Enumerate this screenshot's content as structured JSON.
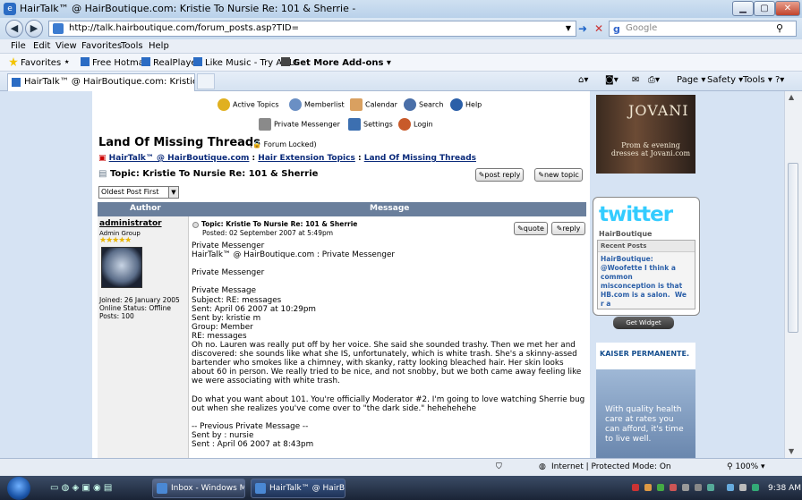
{
  "window": {
    "title": "HairTalk™ @ HairBoutique.com: Kristie To Nursie Re: 101 & Sherrie -"
  },
  "address": {
    "url": "http://talk.hairboutique.com/forum_posts.asp?TID=",
    "search_placeholder": "Google"
  },
  "menu": [
    "File",
    "Edit",
    "View",
    "Favorites",
    "Tools",
    "Help"
  ],
  "favorites_bar": {
    "favorites": "Favorites",
    "items": [
      "Free Hotmail",
      "RealPlayer",
      "Like Music - Try AOL!",
      "Get More Add-ons"
    ]
  },
  "tab": {
    "label": "HairTalk™ @ HairBoutique.com: Kristie To Nursie..."
  },
  "commands": [
    "Page",
    "Safety",
    "Tools"
  ],
  "forum_nav": [
    "Active Topics",
    "Memberlist",
    "Calendar",
    "Search",
    "Help",
    "Private Messenger",
    "Settings",
    "Login"
  ],
  "forum": {
    "title": "Land Of Missing Threads",
    "locked": "Forum Locked",
    "breadcrumb": [
      "HairTalk™ @ HairBoutique.com",
      "Hair Extension Topics",
      "Land Of Missing Threads"
    ],
    "topic": "Topic: Kristie To Nursie Re: 101 & Sherrie",
    "post_reply": "post reply",
    "new_topic": "new topic",
    "sort": "Oldest Post First",
    "col_author": "Author",
    "col_message": "Message"
  },
  "post": {
    "author": "administrator",
    "group": "Admin Group",
    "stars": "★★★★★",
    "joined": "Joined: 26 January 2005",
    "status": "Online Status: Offline",
    "posts": "Posts: 100",
    "title": "Topic: Kristie To Nursie Re: 101 & Sherrie",
    "posted": "Posted: 02 September 2007 at 5:49pm",
    "quote": "quote",
    "reply": "reply",
    "body": "Private Messenger\nHairTalk™ @ HairBoutique.com : Private Messenger\n\nPrivate Messenger\n\nPrivate Message\nSubject: RE: messages\nSent: April 06 2007 at 10:29pm\nSent by: kristie m\nGroup: Member\nRE: messages\nOh no. Lauren was really put off by her voice. She said she sounded trashy. Then we met her and discovered: she sounds like what she IS, unfortunately, which is white trash. She's a skinny-assed bartender who smokes like a chimney, with skanky, ratty looking bleached hair. Her skin looks about 60 in person. We really tried to be nice, and not snobby, but we both came away feeling like we were associating with white trash.\n\nDo what you want about 101. You're officially Moderator #2. I'm going to love watching Sherrie bug out when she realizes you've come over to \"the dark side.\" hehehehehe\n\n-- Previous Private Message --\nSent by : nursie\nSent : April 06 2007 at 8:43pm\n\nyep, i thought about messaging her to de-register me from the site..... but then i thought about"
  },
  "ads": {
    "jovani_brand": "JOVANI",
    "jovani_text": "Prom & evening dresses at Jovani.com",
    "twitter_logo": "twitter",
    "twitter_user": "HairBoutique",
    "recent_posts": "Recent Posts",
    "tweet": "HairBoutique: @Woofette I think a common misconception is that HB.com is a salon.  We r a",
    "get_widget": "Get Widget",
    "kaiser_brand": "KAISER PERMANENTE.",
    "kaiser_text": "With quality health care at rates you can afford, it's time to live well."
  },
  "status": {
    "zone": "Internet | Protected Mode: On",
    "zoom": "100%"
  },
  "taskbar": {
    "items": [
      "Inbox - Windows Mail",
      "HairTalk™ @ HairBo..."
    ],
    "clock": "9:38 AM"
  }
}
